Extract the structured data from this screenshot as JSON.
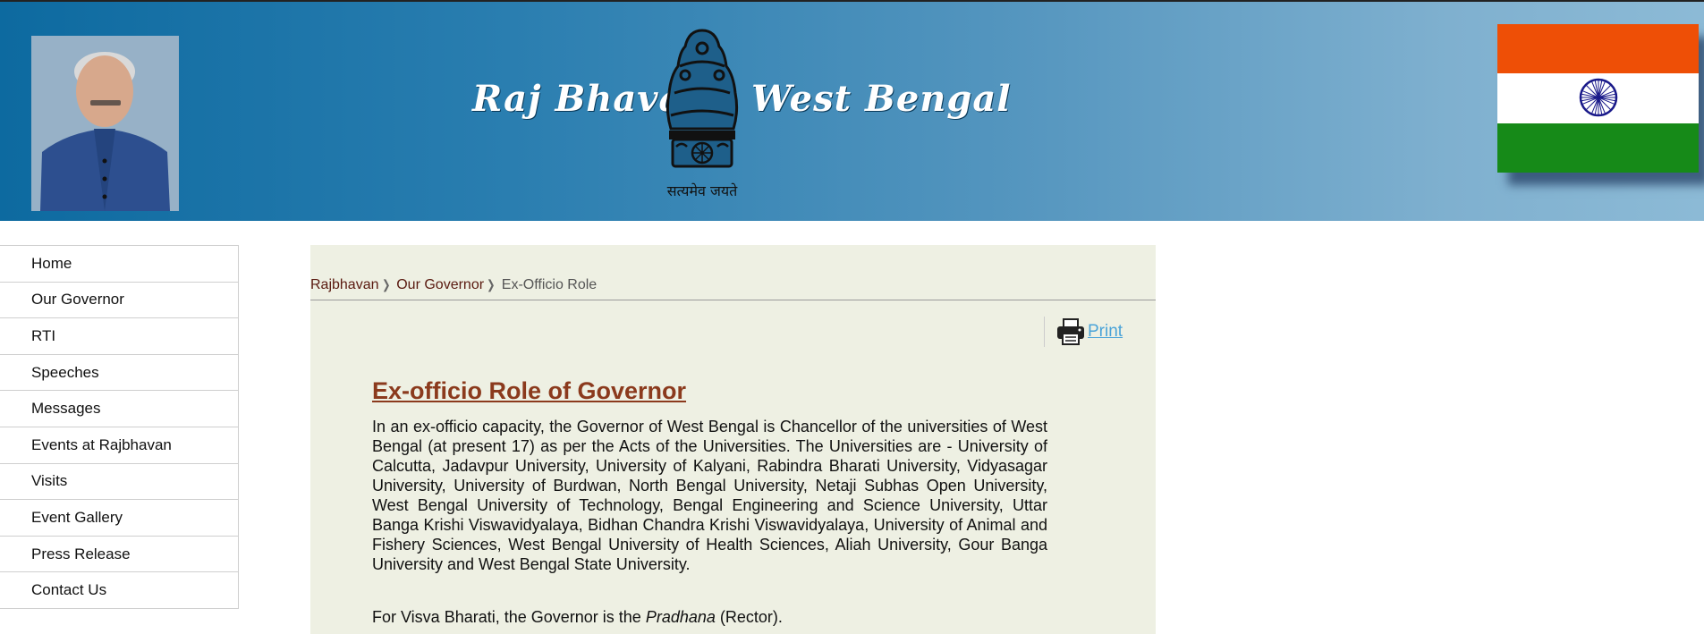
{
  "header": {
    "title_left": "Raj Bhavan",
    "title_right": "West Bengal",
    "motto": "सत्यमेव जयते"
  },
  "colors": {
    "header_gradient_start": "#0d6aa0",
    "header_gradient_end": "#8cbad6",
    "flag_saffron": "#ee4f06",
    "flag_green": "#168a18",
    "flag_chakra": "#1a1a8a",
    "content_bg": "#eef0e3",
    "heading": "#8b3a1d",
    "link": "#4aa3d8"
  },
  "sidebar": {
    "items": [
      {
        "label": "Home"
      },
      {
        "label": "Our Governor"
      },
      {
        "label": "RTI"
      },
      {
        "label": "Speeches"
      },
      {
        "label": "Messages"
      },
      {
        "label": "Events at Rajbhavan"
      },
      {
        "label": "Visits"
      },
      {
        "label": "Event Gallery"
      },
      {
        "label": "Press Release"
      },
      {
        "label": "Contact Us"
      }
    ]
  },
  "breadcrumb": {
    "items": [
      "Rajbhavan",
      "Our Governor"
    ],
    "current": "Ex-Officio Role",
    "separator_icon": "chevron-right-icon"
  },
  "toolbar": {
    "print_label": "Print",
    "print_icon": "printer-icon"
  },
  "article": {
    "heading": "Ex-officio Role of Governor",
    "paragraph1": "In an ex-officio capacity, the Governor of West Bengal is Chancellor of the universities of West Bengal (at present 17) as per the Acts of the Universities. The Universities are - University of Calcutta, Jadavpur University, University of Kalyani, Rabindra Bharati University, Vidyasagar University, University of Burdwan, North Bengal University, Netaji Subhas Open University, West Bengal University of Technology, Bengal Engineering and Science University, Uttar Banga Krishi Viswavidyalaya, Bidhan Chandra Krishi Viswavidyalaya, University of Animal and Fishery Sciences, West Bengal University of Health Sciences, Aliah University, Gour Banga University and West Bengal State University.",
    "paragraph2_prefix": "For Visva Bharati, the Governor is the ",
    "paragraph2_emphasis": "Pradhana",
    "paragraph2_suffix": " (Rector)."
  }
}
